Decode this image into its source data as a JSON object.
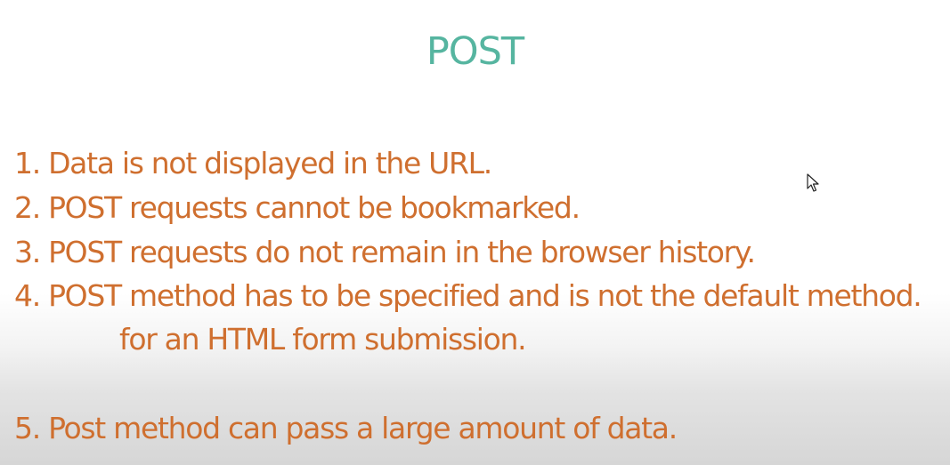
{
  "slide": {
    "title": "POST",
    "lines": [
      "1. Data is not displayed in the URL.",
      "2. POST requests cannot be bookmarked.",
      "3. POST requests do not remain in the browser history.",
      "4. POST method has to be specified and is not the default method.",
      "for an HTML form submission.",
      "5. Post method can pass a large amount of data."
    ]
  },
  "colors": {
    "title": "#56b5a0",
    "body_text": "#cf6f2f",
    "background_top": "#ffffff",
    "background_bottom": "#d6d6d6"
  },
  "icons": {
    "cursor": "mouse-pointer-icon"
  }
}
